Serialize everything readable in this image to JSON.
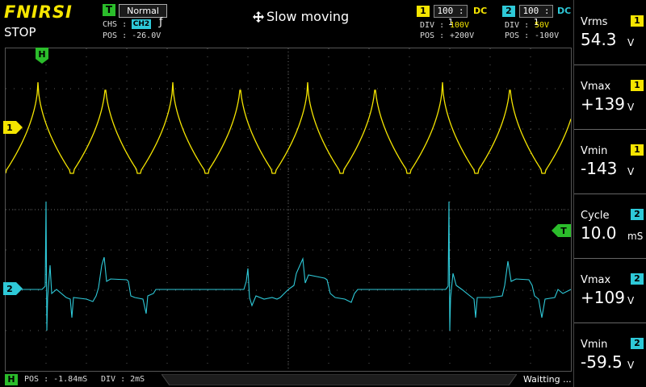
{
  "header": {
    "brand": "FNIRSI",
    "run_state": "STOP",
    "trigger_badge": "T",
    "trigger_mode": "Normal",
    "chs_label": "CHS :",
    "chs_value": "CH2",
    "trigger_edge": "ƒ",
    "pos_label": "POS : -26.0V",
    "slow_moving": "Slow moving"
  },
  "channels": [
    {
      "id": "1",
      "probe": "100 : 1",
      "coupling": "DC",
      "div_label": "DIV :",
      "div_value": "100V",
      "pos_label": "POS :",
      "pos_value": "+200V",
      "color": "#f5e500"
    },
    {
      "id": "2",
      "probe": "100 : 1",
      "coupling": "DC",
      "div_label": "DIV :",
      "div_value": "50V",
      "pos_label": "POS :",
      "pos_value": "-100V",
      "color": "#2ec9d8"
    }
  ],
  "markers": {
    "h_marker": "H",
    "trigger_marker": "T",
    "ch1_marker": "1",
    "ch2_marker": "2"
  },
  "measurements": [
    {
      "label": "Vrms",
      "channel": "1",
      "value": "54.3",
      "unit": "V"
    },
    {
      "label": "Vmax",
      "channel": "1",
      "value": "+139",
      "unit": "V"
    },
    {
      "label": "Vmin",
      "channel": "1",
      "value": "-143",
      "unit": "V"
    },
    {
      "label": "Cycle",
      "channel": "2",
      "value": "10.0",
      "unit": "mS"
    },
    {
      "label": "Vmax",
      "channel": "2",
      "value": "+109",
      "unit": "V"
    },
    {
      "label": "Vmin",
      "channel": "2",
      "value": "-59.5",
      "unit": "V"
    }
  ],
  "footer": {
    "h_badge": "H",
    "pos": "POS : -1.84mS",
    "div": "DIV : 2mS",
    "status": "Waitting ..."
  },
  "colors": {
    "ch1": "#f5e500",
    "ch2": "#2ec9d8",
    "trigger": "#2bbd2b",
    "grid": "#5a5a5a"
  }
}
